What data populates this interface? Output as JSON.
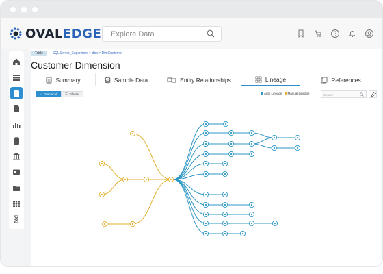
{
  "app": {
    "logo_prefix": "OVAL",
    "logo_suffix": "EDGE"
  },
  "search": {
    "placeholder": "Explore Data"
  },
  "top_icons": [
    "bookmark-icon",
    "cart-icon",
    "help-icon",
    "bell-icon",
    "user-icon"
  ],
  "left_nav": [
    "home-icon",
    "list-icon",
    "document-icon",
    "page-icon",
    "chart-icon",
    "clipboard-icon",
    "bank-icon",
    "card-icon",
    "folder-icon",
    "table-icon",
    "hourglass-icon"
  ],
  "breadcrumb": {
    "tag": "Table",
    "path": "SQLServer_Superstore > dbo > DimCustomer"
  },
  "page_title": "Customer Dimension",
  "tabs": [
    {
      "label": "Summary",
      "icon": "summary-icon"
    },
    {
      "label": "Sample Data",
      "icon": "database-icon"
    },
    {
      "label": "Entity Relationships",
      "icon": "relationship-icon"
    },
    {
      "label": "Lineage",
      "icon": "lineage-icon",
      "active": true
    },
    {
      "label": "References",
      "icon": "references-icon"
    }
  ],
  "view_toggle": {
    "graphical": "Graphical",
    "tabular": "Tabular"
  },
  "legend": {
    "auto": "Auto Lineage",
    "manual": "Manual Lineage"
  },
  "lineage_search": {
    "placeholder": "Search"
  },
  "colors": {
    "auto_lineage": "#2a95c4",
    "manual_lineage": "#e3ae2b",
    "accent": "#2d8fcf"
  }
}
